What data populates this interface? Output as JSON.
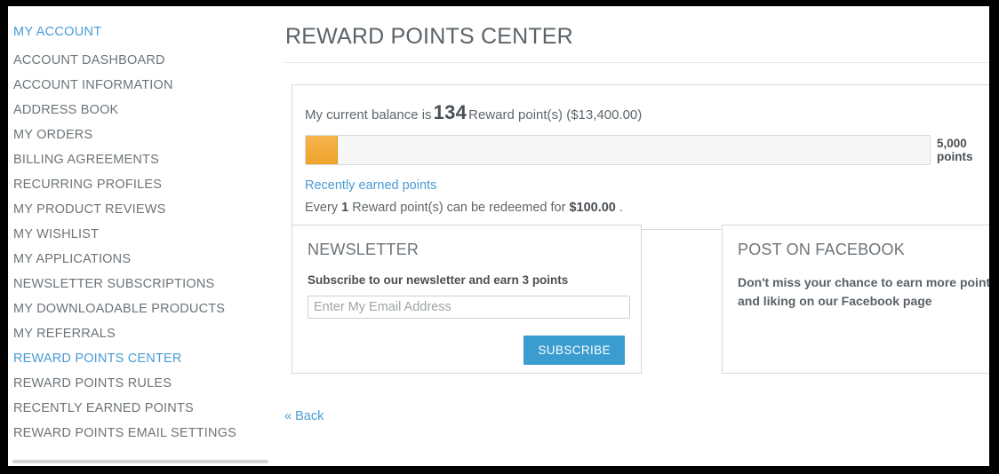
{
  "sidebar": {
    "heading": "MY ACCOUNT",
    "items": [
      {
        "label": "ACCOUNT DASHBOARD",
        "active": false
      },
      {
        "label": "ACCOUNT INFORMATION",
        "active": false
      },
      {
        "label": "ADDRESS BOOK",
        "active": false
      },
      {
        "label": "MY ORDERS",
        "active": false
      },
      {
        "label": "BILLING AGREEMENTS",
        "active": false
      },
      {
        "label": "RECURRING PROFILES",
        "active": false
      },
      {
        "label": "MY PRODUCT REVIEWS",
        "active": false
      },
      {
        "label": "MY WISHLIST",
        "active": false
      },
      {
        "label": "MY APPLICATIONS",
        "active": false
      },
      {
        "label": "NEWSLETTER SUBSCRIPTIONS",
        "active": false
      },
      {
        "label": "MY DOWNLOADABLE PRODUCTS",
        "active": false
      },
      {
        "label": "MY REFERRALS",
        "active": false
      },
      {
        "label": "REWARD POINTS CENTER",
        "active": true
      },
      {
        "label": "REWARD POINTS RULES",
        "active": false
      },
      {
        "label": "RECENTLY EARNED POINTS",
        "active": false
      },
      {
        "label": "REWARD POINTS EMAIL SETTINGS",
        "active": false
      }
    ]
  },
  "main": {
    "title": "REWARD POINTS CENTER",
    "balance": {
      "prefix": "My current balance is",
      "value": "134",
      "suffix": "Reward point(s) ($13,400.00)",
      "progress_max_line1": "5,000",
      "progress_max_line2": "points",
      "progress_percent": 5,
      "recent_link": "Recently earned points",
      "redeem_prefix": "Every",
      "redeem_points": "1",
      "redeem_middle": "Reward point(s) can be redeemed for",
      "redeem_amount": "$100.00",
      "redeem_suffix": "."
    },
    "newsletter": {
      "title": "NEWSLETTER",
      "subtitle": "Subscribe to our newsletter and earn 3 points",
      "email_value": "",
      "email_placeholder": "Enter My Email Address",
      "subscribe_label": "SUBSCRIBE"
    },
    "facebook": {
      "title": "POST ON FACEBOOK",
      "text": "Don't miss your chance to earn more points by posting, sharing and liking on our Facebook page"
    },
    "back_link": "« Back"
  },
  "colors": {
    "link_blue": "#4a9bd4",
    "button_blue": "#3b9cd0",
    "progress_orange": "#f0a32d",
    "text_gray": "#5f666b"
  }
}
